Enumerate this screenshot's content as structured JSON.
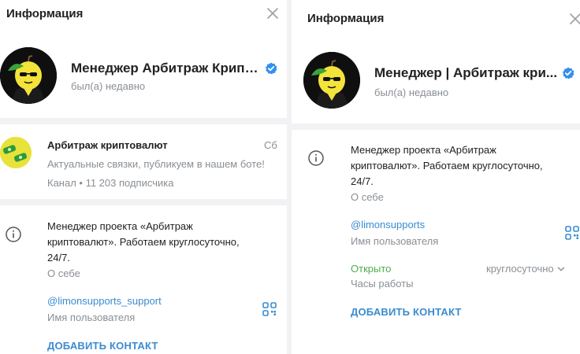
{
  "left": {
    "header_title": "Информация",
    "profile": {
      "name": "Менеджер Арбитраж Крипт...",
      "status": "был(а) недавно"
    },
    "channel": {
      "title": "Арбитраж криптовалют",
      "date": "Сб",
      "message": "Актуальные связки, публикуем в нашем боте!",
      "meta": "Канал • 11 203 подписчика"
    },
    "bio": {
      "line1": "Менеджер проекта «Арбитраж",
      "line2": "криптовалют». Работаем круглосуточно,",
      "line3": "24/7.",
      "label": "О себе"
    },
    "username": {
      "value": "@limonsupports_support",
      "label": "Имя пользователя"
    },
    "add_contact": "ДОБАВИТЬ КОНТАКТ"
  },
  "right": {
    "header_title": "Информация",
    "profile": {
      "name": "Менеджер | Арбитраж кри...",
      "status": "был(а) недавно"
    },
    "bio": {
      "line1": "Менеджер проекта «Арбитраж",
      "line2": "криптовалют». Работаем круглосуточно,",
      "line3": "24/7.",
      "label": "О себе"
    },
    "username": {
      "value": "@limonsupports",
      "label": "Имя пользователя"
    },
    "hours": {
      "status": "Открыто",
      "value": "круглосуточно",
      "label": "Часы работы"
    },
    "add_contact": "ДОБАВИТЬ КОНТАКТ"
  },
  "icons": {
    "close": "close-icon",
    "verified": "verified-badge-icon",
    "info": "info-icon",
    "qr": "qr-code-icon",
    "chevron": "chevron-down-icon"
  },
  "colors": {
    "accent": "#3a8bd0",
    "verified": "#3390ec",
    "open_status": "#4fae4e",
    "secondary_text": "#8a8f94",
    "separator": "#f1f2f4"
  }
}
